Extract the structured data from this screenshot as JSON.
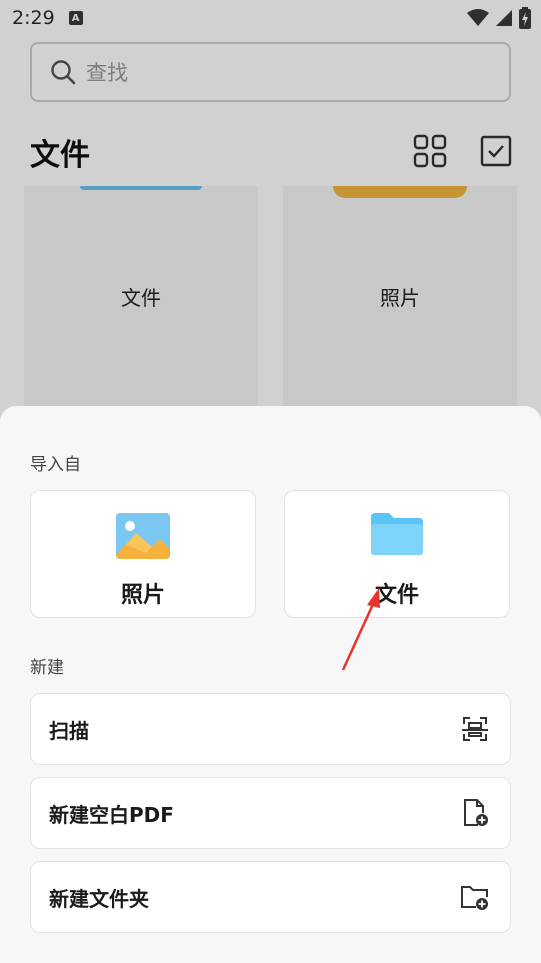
{
  "status_bar": {
    "time": "2:29",
    "notification_glyph": "A"
  },
  "search": {
    "placeholder": "查找"
  },
  "header": {
    "title": "文件"
  },
  "folders": [
    {
      "label": "文件",
      "accent": "#6cc3f0"
    },
    {
      "label": "照片",
      "accent": "#f2b53d"
    }
  ],
  "sheet": {
    "import_label": "导入自",
    "import_options": [
      {
        "label": "照片",
        "icon": "photo-icon"
      },
      {
        "label": "文件",
        "icon": "folder-icon"
      }
    ],
    "new_label": "新建",
    "new_options": [
      {
        "label": "扫描",
        "icon": "scan-icon"
      },
      {
        "label": "新建空白PDF",
        "icon": "new-file-icon"
      },
      {
        "label": "新建文件夹",
        "icon": "new-folder-icon"
      }
    ]
  },
  "colors": {
    "arrow": "#e8322b",
    "photo_sky": "#7ac8f2",
    "photo_mountain": "#f5b13a",
    "folder_blue": "#5cc4f4"
  }
}
